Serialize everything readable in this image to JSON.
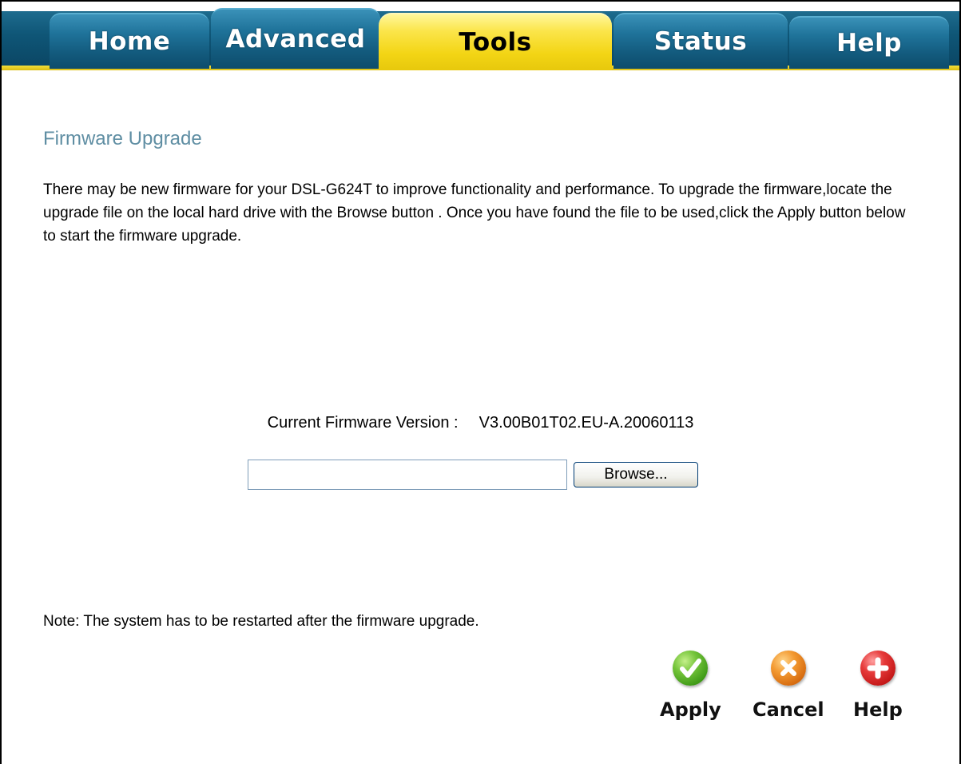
{
  "tabs": [
    {
      "label": "Home",
      "active": false
    },
    {
      "label": "Advanced",
      "active": false
    },
    {
      "label": "Tools",
      "active": true
    },
    {
      "label": "Status",
      "active": false
    },
    {
      "label": "Help",
      "active": false
    }
  ],
  "colors": {
    "tab_blue": "#135b7e",
    "tab_active": "#f3d515",
    "title": "#5f8ea3"
  },
  "page": {
    "title": "Firmware Upgrade",
    "intro": "There may be new firmware for your DSL-G624T to improve functionality and performance. To upgrade the firmware,locate the upgrade file on the local hard drive with the Browse button . Once you have found the file to be used,click the Apply button below to start the firmware upgrade.",
    "firmware_label": "Current Firmware Version :",
    "firmware_version": "V3.00B01T02.EU-A.20060113",
    "file_value": "",
    "browse_label": "Browse...",
    "note": "Note: The system has to be restarted after the firmware upgrade."
  },
  "actions": {
    "apply": {
      "label": "Apply",
      "icon": "check-icon"
    },
    "cancel": {
      "label": "Cancel",
      "icon": "x-icon"
    },
    "help": {
      "label": "Help",
      "icon": "plus-icon"
    }
  }
}
